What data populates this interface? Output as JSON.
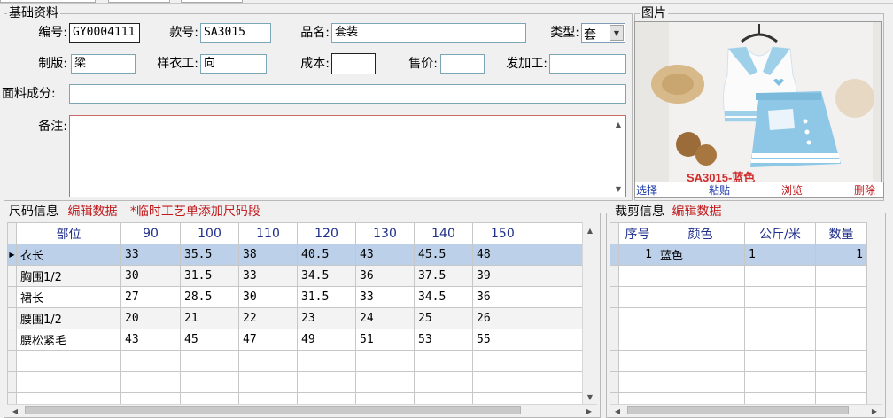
{
  "basic": {
    "title": "基础资料",
    "labels": {
      "code": "编号:",
      "style": "款号:",
      "name": "品名:",
      "type": "类型:",
      "pattern": "制版:",
      "sample": "样衣工:",
      "cost": "成本:",
      "price": "售价:",
      "outsource": "发加工:",
      "fabric": "面料成分:",
      "remark": "备注:"
    },
    "values": {
      "code": "GY0004111",
      "style": "SA3015",
      "name": "套装",
      "type": "套",
      "pattern": "梁",
      "sample": "向",
      "cost": "",
      "price": "",
      "outsource": "",
      "fabric": "",
      "remark": ""
    }
  },
  "picture": {
    "title": "图片",
    "caption": "SA3015-蓝色",
    "actions": [
      "选择",
      "粘贴",
      "浏览",
      "删除"
    ]
  },
  "size": {
    "title": "尺码信息",
    "edit_link": "编辑数据",
    "note": "*临时工艺单添加尺码段",
    "columns": [
      "部位",
      "90",
      "100",
      "110",
      "120",
      "130",
      "140",
      "150"
    ],
    "rows": [
      [
        "衣长",
        "33",
        "35.5",
        "38",
        "40.5",
        "43",
        "45.5",
        "48"
      ],
      [
        "胸围1/2",
        "30",
        "31.5",
        "33",
        "34.5",
        "36",
        "37.5",
        "39"
      ],
      [
        "裙长",
        "27",
        "28.5",
        "30",
        "31.5",
        "33",
        "34.5",
        "36"
      ],
      [
        "腰围1/2",
        "20",
        "21",
        "22",
        "23",
        "24",
        "25",
        "26"
      ],
      [
        "腰松紧毛",
        "43",
        "45",
        "47",
        "49",
        "51",
        "53",
        "55"
      ]
    ]
  },
  "cut": {
    "title": "裁剪信息",
    "edit_link": "编辑数据",
    "columns": [
      "序号",
      "颜色",
      "公斤/米",
      "数量"
    ],
    "rows": [
      [
        "1",
        "蓝色",
        "1",
        "1"
      ]
    ]
  }
}
